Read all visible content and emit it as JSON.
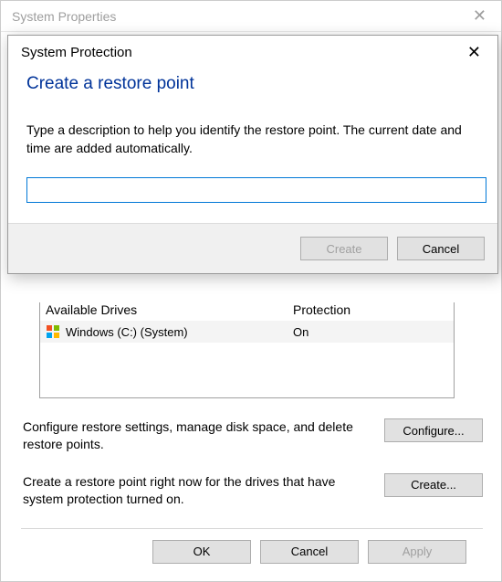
{
  "parent_window": {
    "title": "System Properties",
    "close_icon": "✕",
    "drives": {
      "header_name": "Available Drives",
      "header_protection": "Protection",
      "row": {
        "name": "Windows (C:) (System)",
        "protection": "On"
      }
    },
    "configure_desc": "Configure restore settings, manage disk space, and delete restore points.",
    "configure_btn": "Configure...",
    "create_desc": "Create a restore point right now for the drives that have system protection turned on.",
    "create_btn": "Create...",
    "ok_btn": "OK",
    "cancel_btn": "Cancel",
    "apply_btn": "Apply"
  },
  "dialog": {
    "title": "System Protection",
    "close_icon": "✕",
    "heading": "Create a restore point",
    "desc": "Type a description to help you identify the restore point. The current date and time are added automatically.",
    "input_value": "",
    "create_btn": "Create",
    "cancel_btn": "Cancel"
  }
}
